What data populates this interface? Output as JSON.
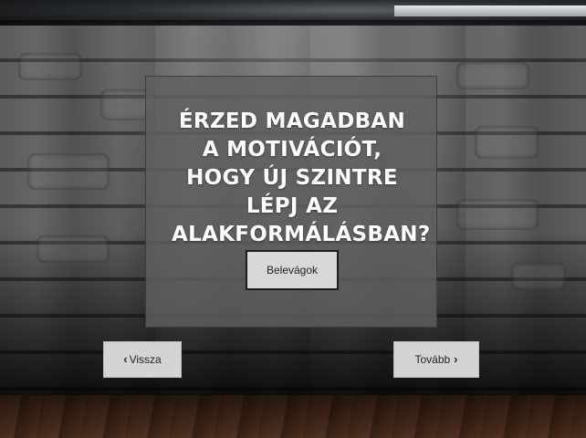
{
  "quiz": {
    "question": "Érzed magadban a motivációt, hogy új szintre lépj az alakformálásban?",
    "answer_label": "Belevágok"
  },
  "navigation": {
    "prev_label": "Vissza",
    "next_label": "Tovább",
    "prev_icon": "chevron-left-icon",
    "next_icon": "chevron-right-icon"
  },
  "colors": {
    "card_background": "#5f5f5f",
    "button_background": "#d8d8d8",
    "text_light": "#ffffff",
    "text_dark": "#222222"
  }
}
